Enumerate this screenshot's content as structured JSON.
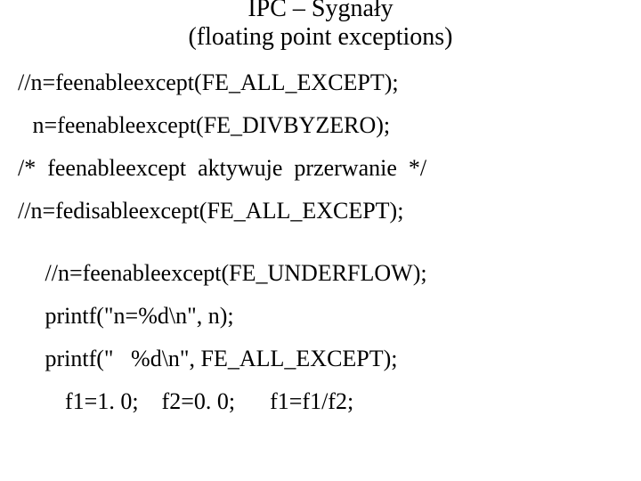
{
  "title": {
    "line1": "IPC – Sygnały",
    "line2": "(floating point exceptions)"
  },
  "code": {
    "l1": "//n=feenableexcept(FE_ALL_EXCEPT);",
    "l2": " n=feenableexcept(FE_DIVBYZERO);",
    "l3": "/*  feenableexcept  aktywuje  przerwanie  */",
    "l4": "//n=fedisableexcept(FE_ALL_EXCEPT);",
    "l5": " //n=feenableexcept(FE_UNDERFLOW);",
    "l6": " printf(\"n=%d\\n\", n);",
    "l7": " printf(\"   %d\\n\", FE_ALL_EXCEPT);",
    "l8": "  f1=1. 0;    f2=0. 0;      f1=f1/f2;"
  }
}
